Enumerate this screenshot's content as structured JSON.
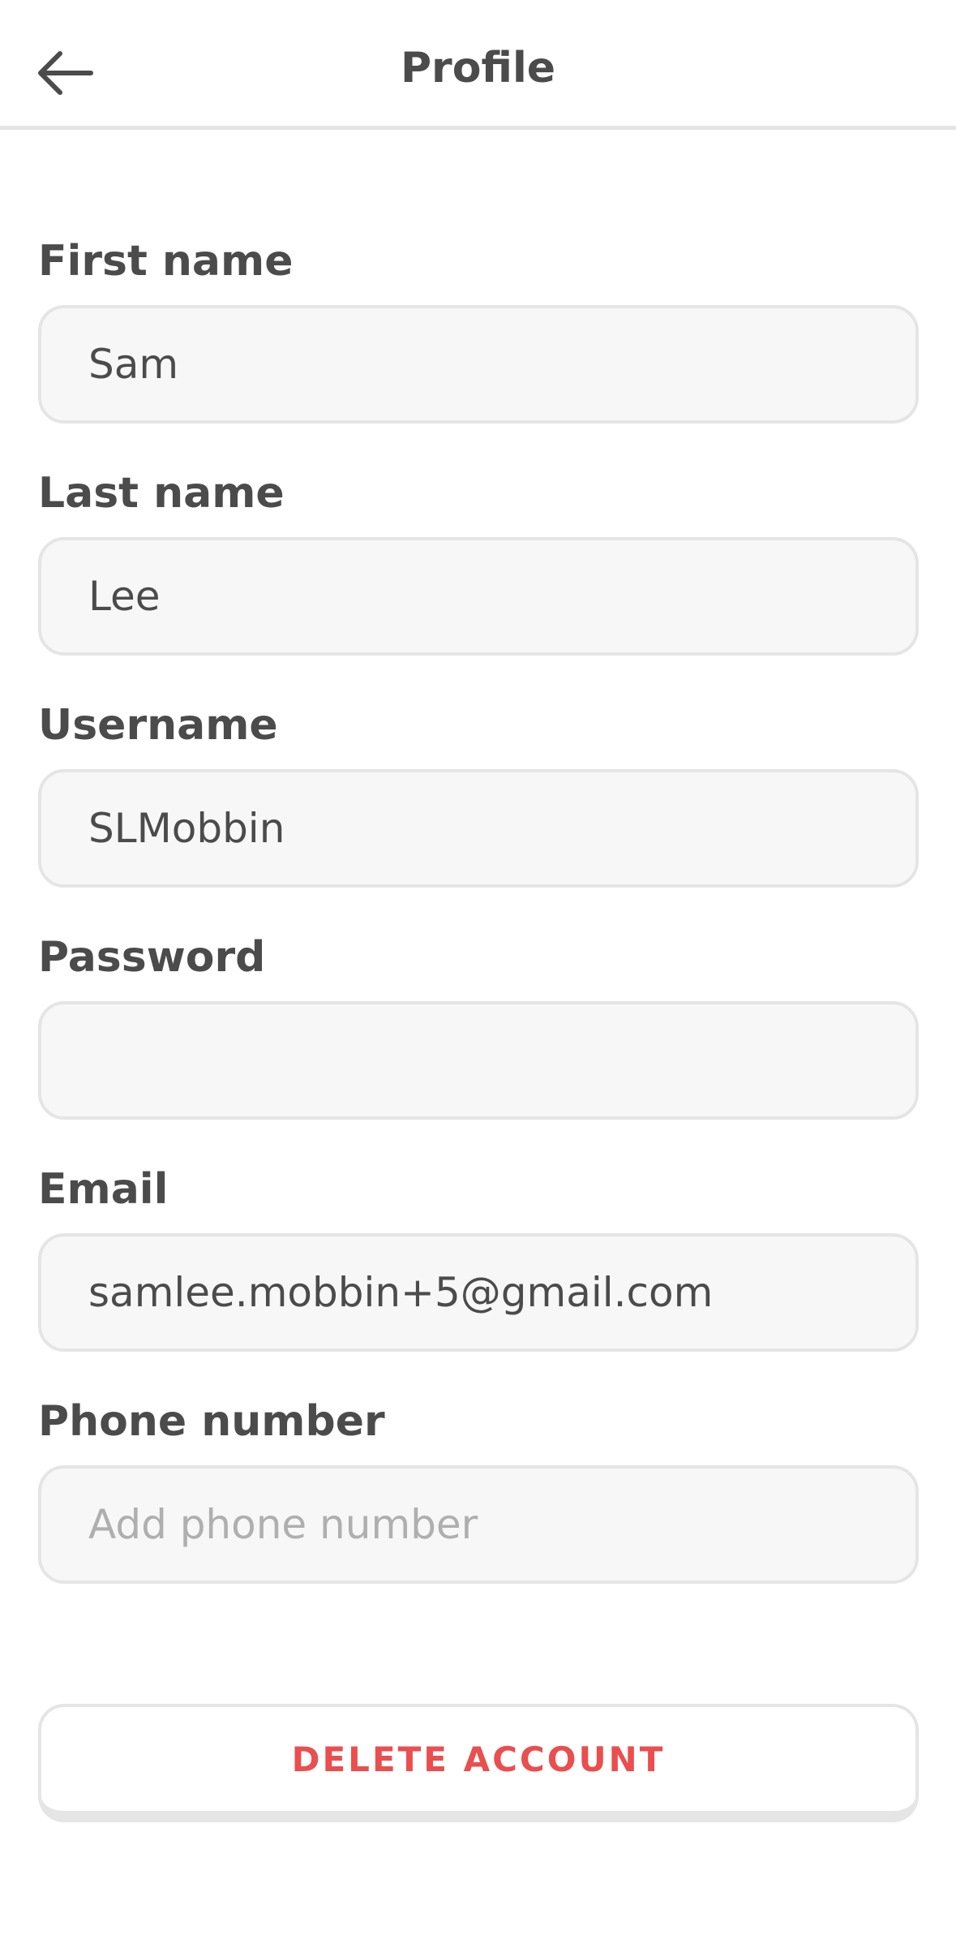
{
  "header": {
    "title": "Profile",
    "back_icon": "arrow-left-icon"
  },
  "fields": {
    "first_name": {
      "label": "First name",
      "value": "Sam",
      "placeholder": ""
    },
    "last_name": {
      "label": "Last name",
      "value": "Lee",
      "placeholder": ""
    },
    "username": {
      "label": "Username",
      "value": "SLMobbin",
      "placeholder": ""
    },
    "password": {
      "label": "Password",
      "value": "",
      "placeholder": ""
    },
    "email": {
      "label": "Email",
      "value": "samlee.mobbin+5@gmail.com",
      "placeholder": ""
    },
    "phone": {
      "label": "Phone number",
      "value": "",
      "placeholder": "Add phone number"
    }
  },
  "actions": {
    "delete_label": "DELETE ACCOUNT"
  },
  "colors": {
    "text": "#4b4b4b",
    "field_bg": "#f7f7f7",
    "border": "#e5e5e5",
    "danger": "#ea4e4e",
    "placeholder": "#afafaf"
  }
}
